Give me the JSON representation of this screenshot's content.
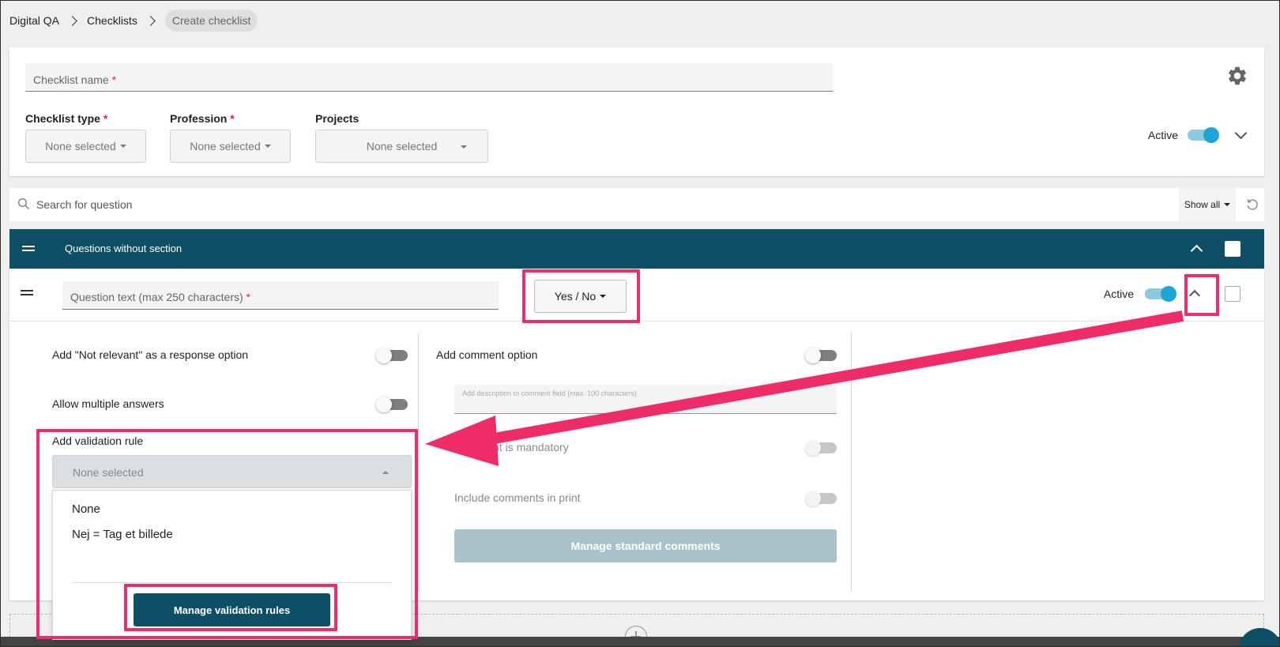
{
  "breadcrumb": [
    "Digital QA",
    "Checklists",
    "Create checklist"
  ],
  "checklist": {
    "name_placeholder": "Checklist name",
    "required_mark": "*",
    "type_label": "Checklist type",
    "type_value": "None selected",
    "profession_label": "Profession",
    "profession_value": "None selected",
    "projects_label": "Projects",
    "projects_value": "None selected",
    "active_label": "Active",
    "active_on": true
  },
  "search": {
    "placeholder": "Search for question",
    "filter_label": "Show all"
  },
  "section": {
    "title": "Questions without section"
  },
  "question": {
    "text_placeholder": "Question text (max 250 characters)",
    "required_mark": "*",
    "answer_type": "Yes / No",
    "active_label": "Active",
    "active_on": true
  },
  "options": {
    "not_relevant_label": "Add \"Not relevant\" as a response option",
    "multiple_answers_label": "Allow multiple answers",
    "validation_label": "Add validation rule",
    "validation_value": "None selected",
    "validation_options": [
      "None",
      "Nej = Tag et billede"
    ],
    "manage_validation_label": "Manage validation rules",
    "comment_option_label": "Add comment option",
    "comment_desc_placeholder": "Add description to comment field (max. 100 characters)",
    "comment_mandatory_label": "Comment is mandatory",
    "comment_print_label": "Include comments in print",
    "manage_standard_label": "Manage standard comments"
  },
  "colors": {
    "primary": "#0e4f66",
    "accent_toggle": "#1ea6d8",
    "required": "#d9263b",
    "annotation": "#ee2d68"
  },
  "icons": [
    "gear-icon",
    "search-icon",
    "refresh-icon",
    "drag-handle-icon",
    "chevron-up-icon",
    "chevron-down-icon",
    "plus-circle-icon"
  ]
}
